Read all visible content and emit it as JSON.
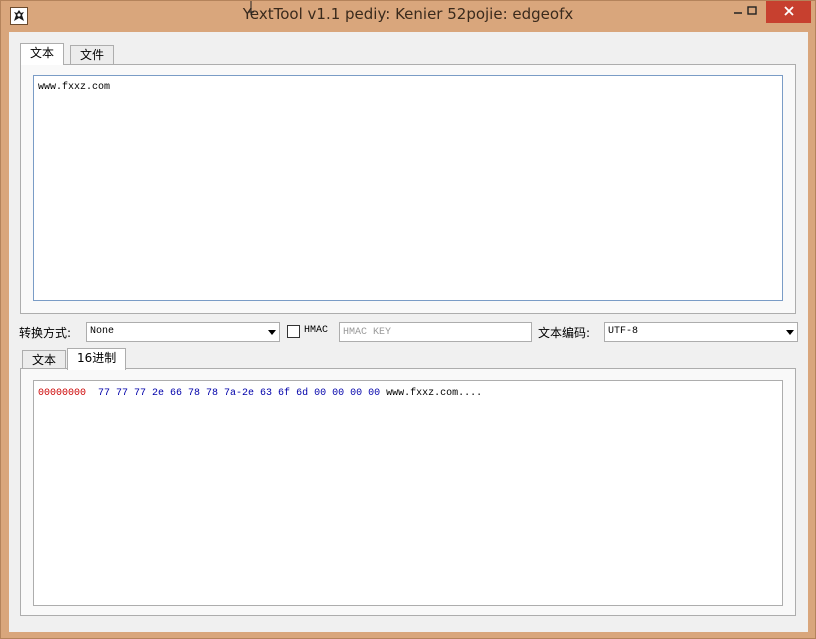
{
  "window": {
    "title": "YextTool v1.1 pediy: Kenier 52pojie: edgeofx"
  },
  "titlebar": {
    "icons": [
      "app-icon",
      "minimize-icon",
      "maximize-icon",
      "close-icon"
    ],
    "close_color": "#c7402f"
  },
  "input_tabs": [
    {
      "label": "文本",
      "active": true
    },
    {
      "label": "文件",
      "active": false
    }
  ],
  "input_text": "www.fxxz.com",
  "controls": {
    "convert_label": "转换方式:",
    "convert_value": "None",
    "hmac_label": "HMAC",
    "hmac_checked": false,
    "hmac_key_placeholder": "HMAC KEY",
    "encoding_label": "文本编码:",
    "encoding_value": "UTF-8"
  },
  "output_tabs": [
    {
      "label": "文本",
      "active": false
    },
    {
      "label": "16进制",
      "active": true
    }
  ],
  "hex_dump": [
    {
      "offset": "00000000",
      "bytes": "77 77 77 2e 66 78 78 7a-2e 63 6f 6d 00 00 00 00",
      "ascii": "www.fxxz.com...."
    }
  ],
  "colors": {
    "window_frame": "#d9a67c",
    "hex_offset": "#cc0000",
    "hex_bytes": "#0000aa",
    "input_border": "#7a9cc6"
  }
}
